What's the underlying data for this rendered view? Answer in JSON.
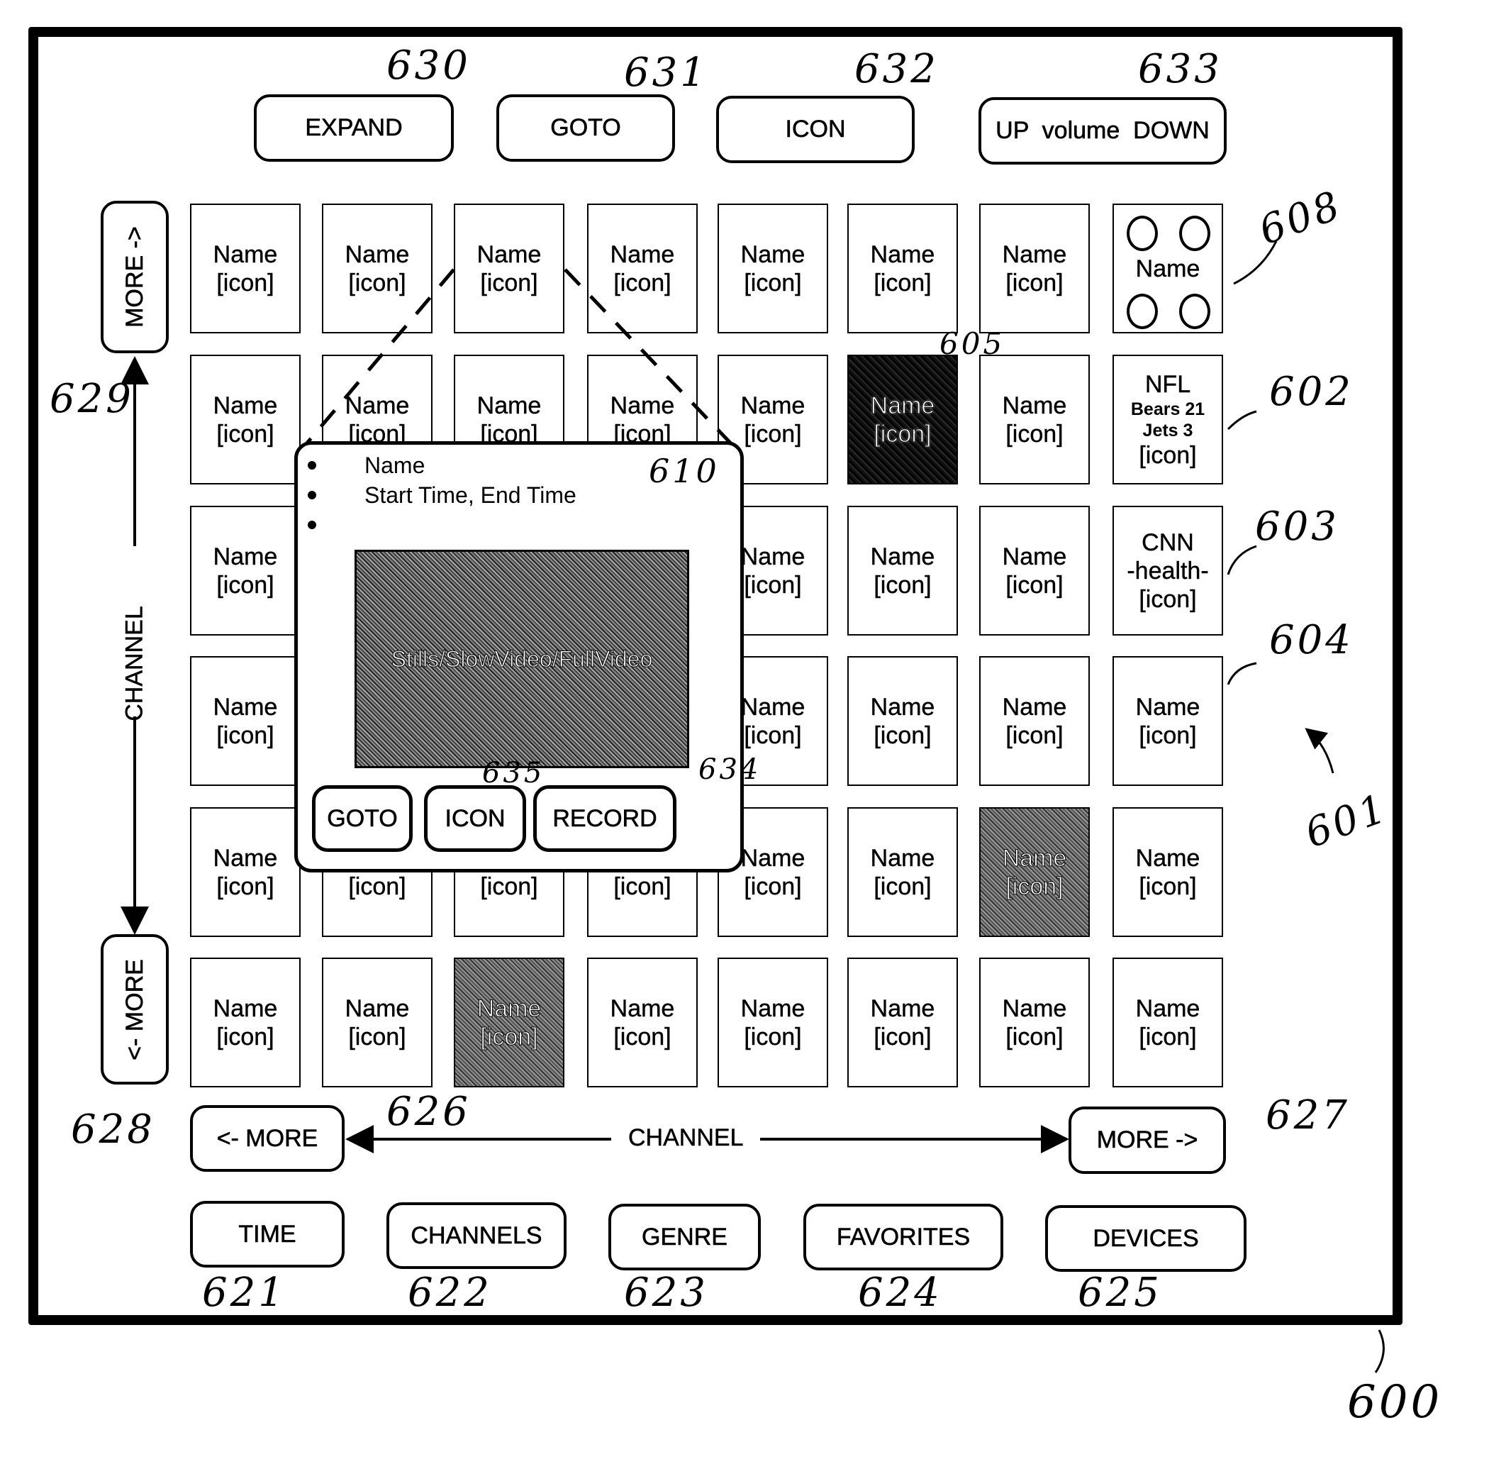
{
  "figure_number": "600",
  "top_toolbar": {
    "buttons": [
      {
        "label": "EXPAND",
        "ref": "630"
      },
      {
        "label": "GOTO",
        "ref": "631"
      },
      {
        "label": "ICON",
        "ref": "632"
      },
      {
        "label": "UP  volume  DOWN",
        "ref": "633"
      }
    ]
  },
  "vertical_nav": {
    "more_up_label": "MORE ->",
    "more_up_ref": "629",
    "more_down_label": "<- MORE",
    "more_down_ref": "628",
    "axis_label": "CHANNEL"
  },
  "horizontal_nav": {
    "more_left_label": "<- MORE",
    "more_left_ref": "626",
    "more_right_label": "MORE ->",
    "more_right_ref": "627",
    "axis_label": "CHANNEL"
  },
  "grid": {
    "ref": "601",
    "default_name": "Name",
    "default_icon": "[icon]",
    "rows": [
      [
        {
          "t": "n"
        },
        {
          "t": "n"
        },
        {
          "t": "n"
        },
        {
          "t": "n"
        },
        {
          "t": "n"
        },
        {
          "t": "n"
        },
        {
          "t": "n"
        },
        {
          "t": "multi",
          "name": "Name",
          "ref": "608"
        }
      ],
      [
        {
          "t": "n"
        },
        {
          "t": "n"
        },
        {
          "t": "n"
        },
        {
          "t": "n"
        },
        {
          "t": "n"
        },
        {
          "t": "n",
          "style": "dark",
          "ref": "605"
        },
        {
          "t": "n"
        },
        {
          "t": "sports",
          "lines": [
            "NFL",
            "Bears 21",
            "Jets 3",
            "[icon]"
          ],
          "ref": "602"
        }
      ],
      [
        {
          "t": "n"
        },
        {
          "t": "n"
        },
        {
          "t": "n"
        },
        {
          "t": "n"
        },
        {
          "t": "n"
        },
        {
          "t": "n"
        },
        {
          "t": "n"
        },
        {
          "t": "news",
          "lines": [
            "CNN",
            "-health-",
            "[icon]"
          ],
          "ref": "603"
        }
      ],
      [
        {
          "t": "n"
        },
        {
          "t": "n"
        },
        {
          "t": "n"
        },
        {
          "t": "n"
        },
        {
          "t": "n"
        },
        {
          "t": "n"
        },
        {
          "t": "n"
        },
        {
          "t": "n",
          "ref": "604"
        }
      ],
      [
        {
          "t": "n"
        },
        {
          "t": "n"
        },
        {
          "t": "n"
        },
        {
          "t": "n"
        },
        {
          "t": "n"
        },
        {
          "t": "n"
        },
        {
          "t": "n",
          "style": "grey"
        },
        {
          "t": "n"
        }
      ],
      [
        {
          "t": "n"
        },
        {
          "t": "n"
        },
        {
          "t": "n",
          "style": "grey"
        },
        {
          "t": "n"
        },
        {
          "t": "n"
        },
        {
          "t": "n"
        },
        {
          "t": "n"
        },
        {
          "t": "n"
        }
      ]
    ]
  },
  "popup": {
    "ref": "610",
    "bullets": [
      "Name",
      "Start Time, End Time",
      ""
    ],
    "preview_label": "Stills/SlowVideo/FullVideo",
    "buttons": [
      {
        "label": "GOTO"
      },
      {
        "label": "ICON",
        "ref": "635"
      },
      {
        "label": "RECORD",
        "ref": "634"
      }
    ]
  },
  "bottom_tabs": [
    {
      "label": "TIME",
      "ref": "621"
    },
    {
      "label": "CHANNELS",
      "ref": "622"
    },
    {
      "label": "GENRE",
      "ref": "623"
    },
    {
      "label": "FAVORITES",
      "ref": "624"
    },
    {
      "label": "DEVICES",
      "ref": "625"
    }
  ]
}
